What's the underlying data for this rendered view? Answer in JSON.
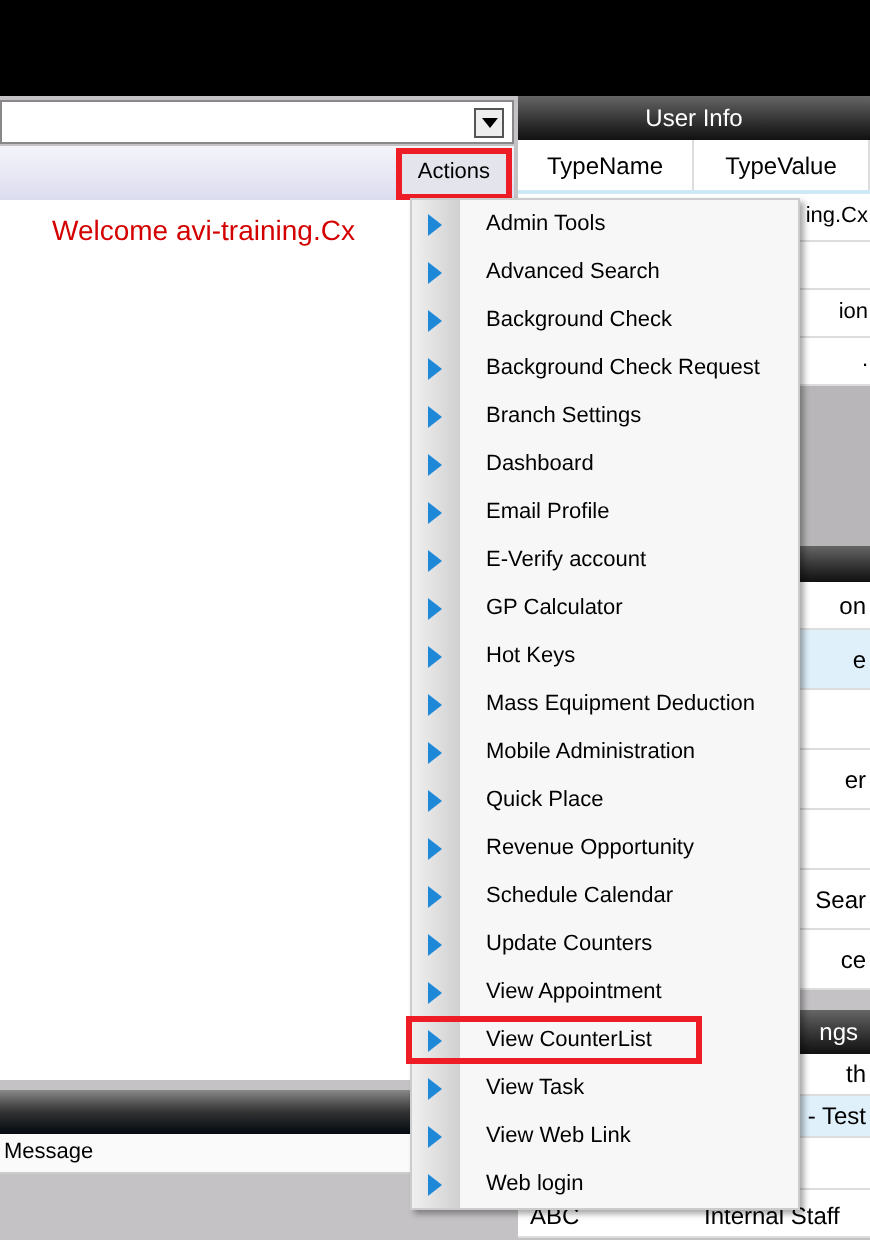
{
  "toolbar": {
    "actions_button": {
      "label": "Actions",
      "highlighted": true
    }
  },
  "welcome": "Welcome avi-training.Cx",
  "message_panel": {
    "column": "Message"
  },
  "user_info": {
    "title": "User Info",
    "columns": [
      "TypeName",
      "TypeValue"
    ],
    "rows": [
      {
        "value": "ing.Cx"
      },
      {
        "value": ""
      },
      {
        "value": "ion"
      },
      {
        "value": "."
      }
    ]
  },
  "second_table": {
    "header": "on",
    "rows": [
      {
        "value": "e",
        "selected": true
      },
      {
        "value": "",
        "selected": false
      },
      {
        "value": "er",
        "selected": false
      },
      {
        "value": "",
        "selected": false
      },
      {
        "value": "Sear",
        "selected": false
      },
      {
        "value": "ce",
        "selected": false
      }
    ]
  },
  "third_table": {
    "title": "ngs",
    "rows": [
      {
        "name": "",
        "value": "th",
        "selected": false
      },
      {
        "name": "",
        "value": "- Test",
        "selected": true
      },
      {
        "name": "",
        "value": "",
        "selected": false
      },
      {
        "name": "ABC",
        "value": "Internal Staff",
        "selected": false
      }
    ]
  },
  "menu": [
    {
      "label": "Admin Tools",
      "highlighted": false
    },
    {
      "label": "Advanced Search",
      "highlighted": false
    },
    {
      "label": "Background Check",
      "highlighted": false
    },
    {
      "label": "Background Check Request",
      "highlighted": false
    },
    {
      "label": "Branch Settings",
      "highlighted": false
    },
    {
      "label": "Dashboard",
      "highlighted": false
    },
    {
      "label": "Email Profile",
      "highlighted": false
    },
    {
      "label": "E-Verify account",
      "highlighted": false
    },
    {
      "label": "GP Calculator",
      "highlighted": false
    },
    {
      "label": "Hot Keys",
      "highlighted": false
    },
    {
      "label": "Mass Equipment Deduction",
      "highlighted": false
    },
    {
      "label": "Mobile Administration",
      "highlighted": false
    },
    {
      "label": "Quick Place",
      "highlighted": false
    },
    {
      "label": "Revenue Opportunity",
      "highlighted": false
    },
    {
      "label": "Schedule Calendar",
      "highlighted": false
    },
    {
      "label": "Update Counters",
      "highlighted": false
    },
    {
      "label": "View Appointment",
      "highlighted": false
    },
    {
      "label": "View CounterList",
      "highlighted": true
    },
    {
      "label": "View Task",
      "highlighted": false
    },
    {
      "label": "View Web Link",
      "highlighted": false
    },
    {
      "label": "Web login",
      "highlighted": false
    }
  ]
}
